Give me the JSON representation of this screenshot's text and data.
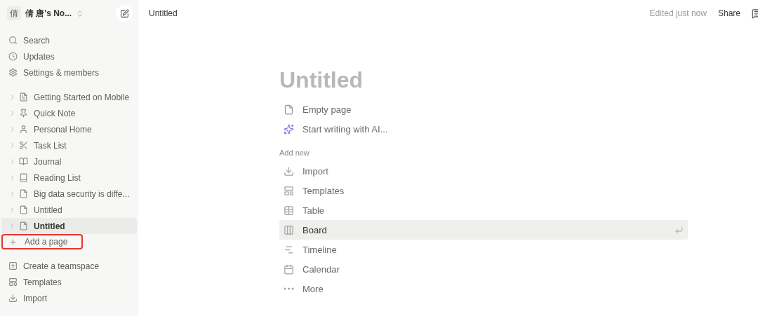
{
  "workspace": {
    "avatar": "倩",
    "name": "倩 唐's No..."
  },
  "nav": [
    {
      "label": "Search"
    },
    {
      "label": "Updates"
    },
    {
      "label": "Settings & members"
    }
  ],
  "pages": [
    {
      "label": "Getting Started on Mobile",
      "selected": false
    },
    {
      "label": "Quick Note",
      "selected": false
    },
    {
      "label": "Personal Home",
      "selected": false
    },
    {
      "label": "Task List",
      "selected": false
    },
    {
      "label": "Journal",
      "selected": false
    },
    {
      "label": "Reading List",
      "selected": false
    },
    {
      "label": "Big data security is diffe...",
      "selected": false
    },
    {
      "label": "Untitled",
      "selected": false
    },
    {
      "label": "Untitled",
      "selected": true
    }
  ],
  "add_page": {
    "label": "Add a page",
    "highlighted": true
  },
  "bottom_nav": [
    {
      "label": "Create a teamspace"
    },
    {
      "label": "Templates"
    },
    {
      "label": "Import"
    }
  ],
  "topbar": {
    "title": "Untitled",
    "status": "Edited just now",
    "share": "Share"
  },
  "page": {
    "title_placeholder": "Untitled",
    "starters": [
      {
        "label": "Empty page"
      },
      {
        "label": "Start writing with AI..."
      }
    ],
    "section": "Add new",
    "options": [
      {
        "label": "Import",
        "selected": false
      },
      {
        "label": "Templates",
        "selected": false
      },
      {
        "label": "Table",
        "selected": false
      },
      {
        "label": "Board",
        "selected": true
      },
      {
        "label": "Timeline",
        "selected": false
      },
      {
        "label": "Calendar",
        "selected": false
      },
      {
        "label": "More",
        "selected": false
      }
    ]
  }
}
